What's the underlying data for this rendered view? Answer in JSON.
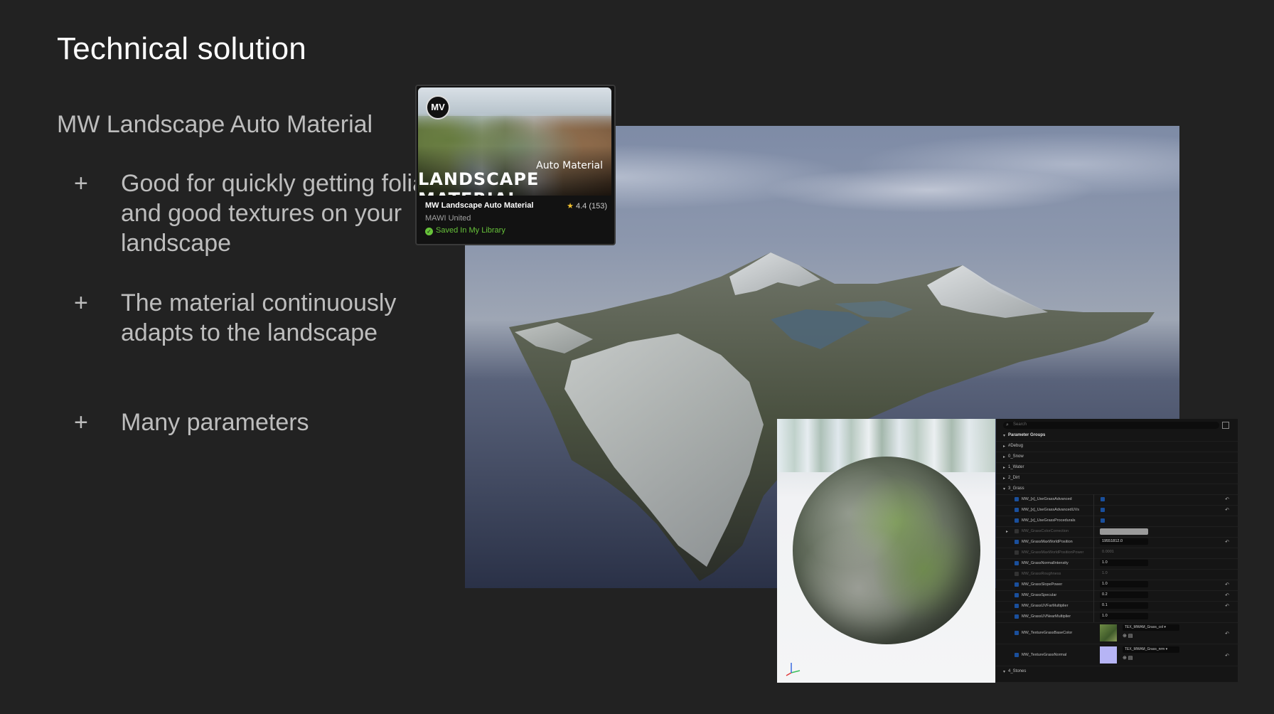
{
  "slide": {
    "title": "Technical solution",
    "subtitle": "MW Landscape Auto Material",
    "bullets": [
      {
        "marker": "+",
        "text": "Good for quickly getting foliage and good textures on your landscape"
      },
      {
        "marker": "+",
        "text": "The material continuously adapts to the landscape"
      },
      {
        "marker": "+",
        "text": "Many parameters"
      }
    ]
  },
  "card": {
    "logo": "MV",
    "banner_sub": "Auto Material",
    "banner_main": "LANDSCAPE MATERIAL",
    "name": "MW Landscape Auto Material",
    "rating": "4.4",
    "rating_count": "(153)",
    "vendor": "MAWI United",
    "saved": "Saved In My Library",
    "colors": {
      "saved": "#67c23a",
      "star": "#f2c230"
    }
  },
  "panel": {
    "search_placeholder": "Search",
    "groups_header": "Parameter Groups",
    "groups_collapsed": [
      "#Debug",
      "0_Snow",
      "1_Water",
      "2_Dirt"
    ],
    "open_group": "3_Grass",
    "params": [
      {
        "label": "MW_[x]_UseGrassAdvanced",
        "value": "",
        "kind": "check",
        "enabled": true,
        "reset": true
      },
      {
        "label": "MW_[x]_UseGrassAdvancedUVs",
        "value": "",
        "kind": "check",
        "enabled": true,
        "reset": true
      },
      {
        "label": "MW_[x]_UseGrassProcedurals",
        "value": "",
        "kind": "check",
        "enabled": true,
        "reset": false
      },
      {
        "label": "MW_GrassColorCorrection",
        "value": "",
        "kind": "swatch",
        "enabled": false,
        "reset": false
      },
      {
        "label": "MW_GrassMaxWorldPosition",
        "value": "19551812.0",
        "kind": "num",
        "enabled": true,
        "reset": true
      },
      {
        "label": "MW_GrassMaxWorldPositionPower",
        "value": "0.0001",
        "kind": "num",
        "enabled": false,
        "reset": false
      },
      {
        "label": "MW_GrassNormalIntensity",
        "value": "1.0",
        "kind": "num",
        "enabled": true,
        "reset": false
      },
      {
        "label": "MW_GrassRoughness",
        "value": "1.0",
        "kind": "num",
        "enabled": false,
        "reset": false
      },
      {
        "label": "MW_GrassSlopePower",
        "value": "1.0",
        "kind": "num",
        "enabled": true,
        "reset": true
      },
      {
        "label": "MW_GrassSpecular",
        "value": "0.2",
        "kind": "num",
        "enabled": true,
        "reset": true
      },
      {
        "label": "MW_GrassUVFarMultiplier",
        "value": "0.1",
        "kind": "num",
        "enabled": true,
        "reset": true
      },
      {
        "label": "MW_GrassUVNearMultiplier",
        "value": "1.0",
        "kind": "num",
        "enabled": true,
        "reset": false
      }
    ],
    "textures": [
      {
        "label": "MW_TextureGrassBaseColor",
        "value": "TEX_MWAM_Grass_col",
        "thumb": "#5b7a3a"
      },
      {
        "label": "MW_TextureGrassNormal",
        "value": "TEX_MWAM_Grass_nrm",
        "thumb": "#b6b4f5"
      }
    ],
    "last_group": "4_Stones"
  }
}
